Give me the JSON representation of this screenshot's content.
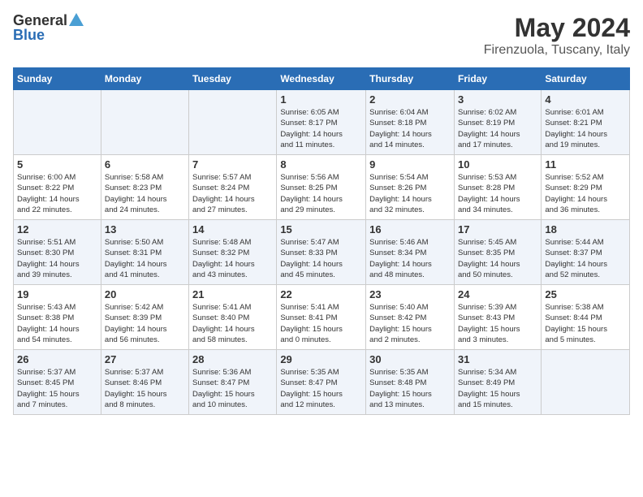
{
  "header": {
    "logo_general": "General",
    "logo_blue": "Blue",
    "month_title": "May 2024",
    "location": "Firenzuola, Tuscany, Italy"
  },
  "days_of_week": [
    "Sunday",
    "Monday",
    "Tuesday",
    "Wednesday",
    "Thursday",
    "Friday",
    "Saturday"
  ],
  "weeks": [
    [
      {
        "day": "",
        "info": ""
      },
      {
        "day": "",
        "info": ""
      },
      {
        "day": "",
        "info": ""
      },
      {
        "day": "1",
        "info": "Sunrise: 6:05 AM\nSunset: 8:17 PM\nDaylight: 14 hours\nand 11 minutes."
      },
      {
        "day": "2",
        "info": "Sunrise: 6:04 AM\nSunset: 8:18 PM\nDaylight: 14 hours\nand 14 minutes."
      },
      {
        "day": "3",
        "info": "Sunrise: 6:02 AM\nSunset: 8:19 PM\nDaylight: 14 hours\nand 17 minutes."
      },
      {
        "day": "4",
        "info": "Sunrise: 6:01 AM\nSunset: 8:21 PM\nDaylight: 14 hours\nand 19 minutes."
      }
    ],
    [
      {
        "day": "5",
        "info": "Sunrise: 6:00 AM\nSunset: 8:22 PM\nDaylight: 14 hours\nand 22 minutes."
      },
      {
        "day": "6",
        "info": "Sunrise: 5:58 AM\nSunset: 8:23 PM\nDaylight: 14 hours\nand 24 minutes."
      },
      {
        "day": "7",
        "info": "Sunrise: 5:57 AM\nSunset: 8:24 PM\nDaylight: 14 hours\nand 27 minutes."
      },
      {
        "day": "8",
        "info": "Sunrise: 5:56 AM\nSunset: 8:25 PM\nDaylight: 14 hours\nand 29 minutes."
      },
      {
        "day": "9",
        "info": "Sunrise: 5:54 AM\nSunset: 8:26 PM\nDaylight: 14 hours\nand 32 minutes."
      },
      {
        "day": "10",
        "info": "Sunrise: 5:53 AM\nSunset: 8:28 PM\nDaylight: 14 hours\nand 34 minutes."
      },
      {
        "day": "11",
        "info": "Sunrise: 5:52 AM\nSunset: 8:29 PM\nDaylight: 14 hours\nand 36 minutes."
      }
    ],
    [
      {
        "day": "12",
        "info": "Sunrise: 5:51 AM\nSunset: 8:30 PM\nDaylight: 14 hours\nand 39 minutes."
      },
      {
        "day": "13",
        "info": "Sunrise: 5:50 AM\nSunset: 8:31 PM\nDaylight: 14 hours\nand 41 minutes."
      },
      {
        "day": "14",
        "info": "Sunrise: 5:48 AM\nSunset: 8:32 PM\nDaylight: 14 hours\nand 43 minutes."
      },
      {
        "day": "15",
        "info": "Sunrise: 5:47 AM\nSunset: 8:33 PM\nDaylight: 14 hours\nand 45 minutes."
      },
      {
        "day": "16",
        "info": "Sunrise: 5:46 AM\nSunset: 8:34 PM\nDaylight: 14 hours\nand 48 minutes."
      },
      {
        "day": "17",
        "info": "Sunrise: 5:45 AM\nSunset: 8:35 PM\nDaylight: 14 hours\nand 50 minutes."
      },
      {
        "day": "18",
        "info": "Sunrise: 5:44 AM\nSunset: 8:37 PM\nDaylight: 14 hours\nand 52 minutes."
      }
    ],
    [
      {
        "day": "19",
        "info": "Sunrise: 5:43 AM\nSunset: 8:38 PM\nDaylight: 14 hours\nand 54 minutes."
      },
      {
        "day": "20",
        "info": "Sunrise: 5:42 AM\nSunset: 8:39 PM\nDaylight: 14 hours\nand 56 minutes."
      },
      {
        "day": "21",
        "info": "Sunrise: 5:41 AM\nSunset: 8:40 PM\nDaylight: 14 hours\nand 58 minutes."
      },
      {
        "day": "22",
        "info": "Sunrise: 5:41 AM\nSunset: 8:41 PM\nDaylight: 15 hours\nand 0 minutes."
      },
      {
        "day": "23",
        "info": "Sunrise: 5:40 AM\nSunset: 8:42 PM\nDaylight: 15 hours\nand 2 minutes."
      },
      {
        "day": "24",
        "info": "Sunrise: 5:39 AM\nSunset: 8:43 PM\nDaylight: 15 hours\nand 3 minutes."
      },
      {
        "day": "25",
        "info": "Sunrise: 5:38 AM\nSunset: 8:44 PM\nDaylight: 15 hours\nand 5 minutes."
      }
    ],
    [
      {
        "day": "26",
        "info": "Sunrise: 5:37 AM\nSunset: 8:45 PM\nDaylight: 15 hours\nand 7 minutes."
      },
      {
        "day": "27",
        "info": "Sunrise: 5:37 AM\nSunset: 8:46 PM\nDaylight: 15 hours\nand 8 minutes."
      },
      {
        "day": "28",
        "info": "Sunrise: 5:36 AM\nSunset: 8:47 PM\nDaylight: 15 hours\nand 10 minutes."
      },
      {
        "day": "29",
        "info": "Sunrise: 5:35 AM\nSunset: 8:47 PM\nDaylight: 15 hours\nand 12 minutes."
      },
      {
        "day": "30",
        "info": "Sunrise: 5:35 AM\nSunset: 8:48 PM\nDaylight: 15 hours\nand 13 minutes."
      },
      {
        "day": "31",
        "info": "Sunrise: 5:34 AM\nSunset: 8:49 PM\nDaylight: 15 hours\nand 15 minutes."
      },
      {
        "day": "",
        "info": ""
      }
    ]
  ]
}
